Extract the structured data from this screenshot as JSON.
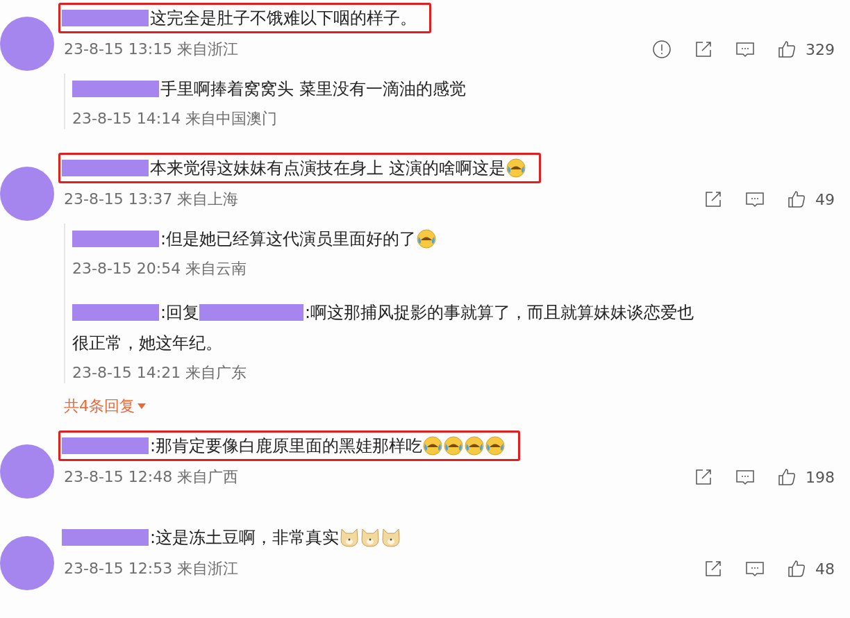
{
  "comments": [
    {
      "highlighted": true,
      "segments": [
        {
          "kind": "name"
        },
        {
          "kind": "text",
          "text": "这完全是肚子不饿难以下咽的样子。"
        }
      ],
      "time": "23-8-15 13:15 来自浙江",
      "report_icon": true,
      "likes": "329",
      "replies": [
        {
          "segments": [
            {
              "kind": "name"
            },
            {
              "kind": "text",
              "text": "手里啊捧着窝窝头 菜里没有一滴油的感觉"
            }
          ],
          "time": "23-8-15 14:14 来自中国澳门"
        }
      ]
    },
    {
      "highlighted": true,
      "segments": [
        {
          "kind": "name"
        },
        {
          "kind": "text",
          "text": "本来觉得这妹妹有点演技在身上 这演的啥啊这是"
        },
        {
          "kind": "laugh-cry-emoji"
        }
      ],
      "time": "23-8-15 13:37 来自上海",
      "report_icon": false,
      "likes": "49",
      "replies": [
        {
          "segments": [
            {
              "kind": "name"
            },
            {
              "kind": "text",
              "text": ":但是她已经算这代演员里面好的了"
            },
            {
              "kind": "laugh-cry-emoji"
            }
          ],
          "time": "23-8-15 20:54 来自云南"
        },
        {
          "segments": [
            {
              "kind": "name"
            },
            {
              "kind": "text",
              "text": ":回复"
            },
            {
              "kind": "name"
            },
            {
              "kind": "text",
              "text": ":啊这那捕风捉影的事就算了，而且就算妹妹谈恋爱也"
            },
            {
              "kind": "text",
              "text": "很正常，她这年纪。"
            }
          ],
          "time": "23-8-15 14:21 来自广东"
        }
      ],
      "more_replies": "共4条回复"
    },
    {
      "highlighted": true,
      "segments": [
        {
          "kind": "name"
        },
        {
          "kind": "text",
          "text": ":那肯定要像白鹿原里面的黑娃那样吃"
        },
        {
          "kind": "laugh-cry-emoji"
        },
        {
          "kind": "laugh-cry-emoji"
        },
        {
          "kind": "laugh-cry-emoji"
        },
        {
          "kind": "laugh-cry-emoji"
        }
      ],
      "time": "23-8-15 12:48 来自广西",
      "report_icon": false,
      "likes": "198"
    },
    {
      "highlighted": false,
      "segments": [
        {
          "kind": "name"
        },
        {
          "kind": "text",
          "text": ":这是冻土豆啊，非常真实"
        },
        {
          "kind": "dog-emoji"
        },
        {
          "kind": "dog-emoji"
        },
        {
          "kind": "dog-emoji"
        }
      ],
      "time": "23-8-15 12:53 来自浙江",
      "report_icon": false,
      "likes": "48"
    }
  ]
}
